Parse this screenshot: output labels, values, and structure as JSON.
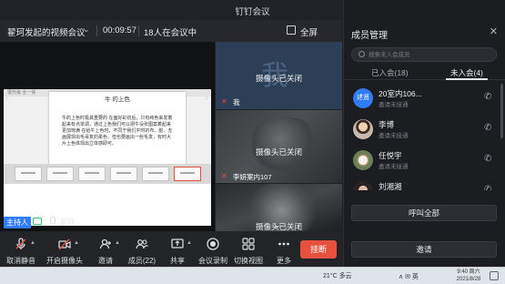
{
  "window": {
    "title": "钉钉会议",
    "controls": {
      "pin": "⊡",
      "minimize": "–",
      "maximize": "□",
      "close": "✕"
    }
  },
  "meeting": {
    "title": "翟珂发起的视频会议",
    "timer": "00:09:57",
    "participants_text": "18人在会议中",
    "fullscreen_label": "全屏"
  },
  "shared_screen": {
    "app_label": "很升级 全一体",
    "slide_title": "牛 的上色",
    "slide_text": "牛的上色时极其重要的 在面好彩初后，只有纯色来发着起来有点单调，通过上色我们可以把牛设张图案着起来更加饱满 在给牛上色时，不同于我们平时的布、脏、无画展现出毛哥复的柔色，但也要画出一些毛发，有时大片上色体现出立体感即可。"
  },
  "host": {
    "tag": "主持人",
    "name": "翟珂"
  },
  "tiles": [
    {
      "big_text": "我",
      "camera_text": "摄像头已关闭",
      "name": "我"
    },
    {
      "camera_text": "摄像头已关闭",
      "name": "李妍案内107"
    },
    {
      "camera_text": "摄像头已关闭",
      "name": ""
    }
  ],
  "toolbar": {
    "items": [
      {
        "label": "取消静音",
        "icon": "mic-icon"
      },
      {
        "label": "开启摄像头",
        "icon": "camera-icon"
      },
      {
        "label": "邀请",
        "icon": "invite-icon"
      },
      {
        "label": "成员(22)",
        "icon": "members-icon"
      },
      {
        "label": "共享",
        "icon": "share-icon"
      },
      {
        "label": "会议录制",
        "icon": "record-icon"
      },
      {
        "label": "切换视图",
        "icon": "grid-icon"
      },
      {
        "label": "更多",
        "icon": "more-icon"
      }
    ],
    "end_label": "挂断"
  },
  "panel": {
    "title": "成员管理",
    "search_placeholder": "搜索未入会成员",
    "tab_joined": "已入会(18)",
    "tab_not_joined": "未入会(4)",
    "members": [
      {
        "avatar": "述贤",
        "name": "20室内106...",
        "status": "邀请未接通"
      },
      {
        "avatar": "",
        "name": "李博",
        "status": "邀请未接通"
      },
      {
        "avatar": "",
        "name": "任悦宇",
        "status": "邀请未接通"
      },
      {
        "avatar": "",
        "name": "刘湘湘",
        "status": ""
      }
    ],
    "call_all_label": "呼叫全部",
    "invite_label": "邀请"
  },
  "taskbar": {
    "weather": "21°C 多云",
    "system": "∧ ✉ 英",
    "time": "9:40 周六",
    "date": "2021/8/28"
  }
}
